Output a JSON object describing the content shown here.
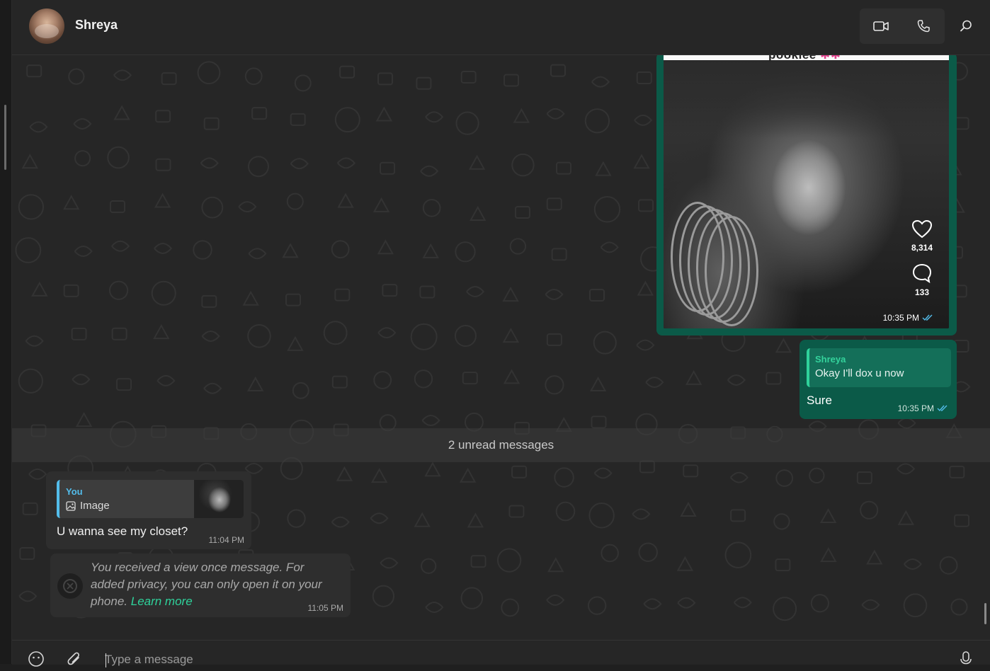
{
  "header": {
    "contact_name": "Shreya",
    "video_call_icon": "video-camera-icon",
    "voice_call_icon": "phone-icon",
    "search_icon": "search-icon"
  },
  "messages": {
    "media_post": {
      "top_caption": "pookiee",
      "top_caption_emoji": "✱✱",
      "likes": "8,314",
      "comments": "133",
      "time": "10:35 PM"
    },
    "reply_sure": {
      "quote_author": "Shreya",
      "quote_text": "Okay I'll dox u now",
      "text": "Sure",
      "time": "10:35 PM"
    },
    "unread_label": "2 unread messages",
    "closet": {
      "quote_author": "You",
      "quote_type": "Image",
      "text": "U wanna see my closet?",
      "time": "11:04 PM"
    },
    "view_once": {
      "text": "You received a view once message. For added privacy, you can only open it on your phone.",
      "link": "Learn more",
      "time": "11:05 PM"
    }
  },
  "composer": {
    "placeholder": "Type a message",
    "emoji_icon": "emoji-icon",
    "attach_icon": "paperclip-icon",
    "mic_icon": "microphone-icon"
  },
  "colors": {
    "outgoing_bubble": "#0b5a48",
    "incoming_bubble": "#2e2e2e",
    "accent_green": "#2fd29b",
    "accent_blue": "#53bdeb"
  }
}
